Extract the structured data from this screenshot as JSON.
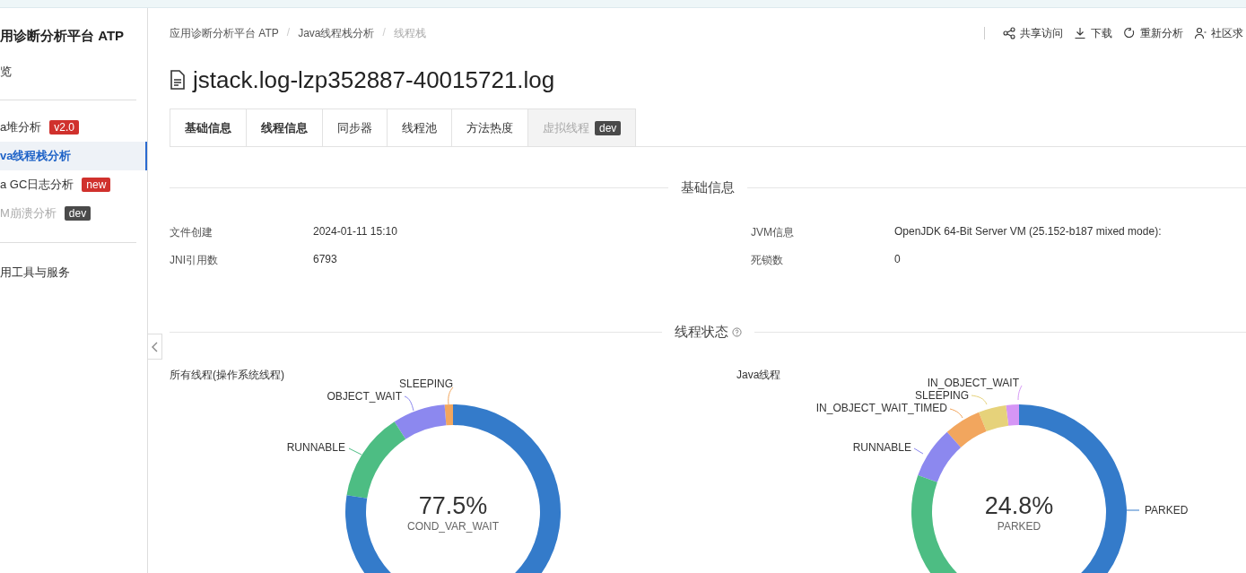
{
  "sidebar": {
    "title": "用诊断分析平台 ATP",
    "overview": "览",
    "items": [
      {
        "label": "a堆分析",
        "badge": {
          "text": "v2.0",
          "color": "#d0312d"
        },
        "selected": false,
        "disabled": false
      },
      {
        "label": "va线程栈分析",
        "selected": true,
        "disabled": false
      },
      {
        "label": "a GC日志分析",
        "badge": {
          "text": "new",
          "color": "#d0312d"
        },
        "selected": false,
        "disabled": false
      },
      {
        "label": "M崩溃分析",
        "badge": {
          "text": "dev",
          "color": "#4a4a4a"
        },
        "selected": false,
        "disabled": true
      }
    ],
    "tools": "用工具与服务"
  },
  "breadcrumb": [
    "应用诊断分析平台 ATP",
    "Java线程栈分析",
    "线程栈"
  ],
  "breadcrumb_separators": [
    "/",
    "/"
  ],
  "actions": [
    {
      "kind": "share",
      "label": "共享访问"
    },
    {
      "kind": "download",
      "label": "下载"
    },
    {
      "kind": "reload",
      "label": "重新分析"
    },
    {
      "kind": "user",
      "label": "社区求"
    }
  ],
  "title": "jstack.log-lzp352887-40015721.log",
  "tabs": [
    {
      "label": "基础信息",
      "selected": true,
      "disabled": false
    },
    {
      "label": "线程信息",
      "selected": true,
      "disabled": false
    },
    {
      "label": "同步器",
      "selected": false,
      "disabled": false
    },
    {
      "label": "线程池",
      "selected": false,
      "disabled": false
    },
    {
      "label": "方法热度",
      "selected": false,
      "disabled": false
    },
    {
      "label": "虚拟线程",
      "badge": "dev",
      "selected": false,
      "disabled": true
    }
  ],
  "basic_section": "基础信息",
  "info": [
    {
      "label": "文件创建",
      "value": "2024-01-11 15:10"
    },
    {
      "label": "JVM信息",
      "value": "OpenJDK 64-Bit Server VM (25.152-b187 mixed mode):"
    },
    {
      "label": "JNI引用数",
      "value": "6793"
    },
    {
      "label": "死锁数",
      "value": "0"
    }
  ],
  "state_section": "线程状态",
  "charts": [
    {
      "title": "所有线程(操作系统线程)",
      "center_value": "77.5%",
      "center_label": "COND_VAR_WAIT",
      "slices": [
        {
          "label": "SLEEPING",
          "color": "#f2a65e"
        },
        {
          "label": "OBJECT_WAIT",
          "color": "#8c88ef"
        },
        {
          "label": "RUNNABLE",
          "color": "#4dbd83"
        },
        {
          "color": "#347bca"
        }
      ]
    },
    {
      "title": "Java线程",
      "center_value": "24.8%",
      "center_label": "PARKED",
      "slices": [
        {
          "label": "IN_OBJECT_WAIT",
          "color": "#d596f5"
        },
        {
          "label": "SLEEPING",
          "color": "#e6d27a"
        },
        {
          "label": "IN_OBJECT_WAIT_TIMED",
          "color": "#f2a65e"
        },
        {
          "label": "RUNNABLE",
          "color": "#8c88ef"
        },
        {
          "label": "PARKED",
          "color": "#347bca"
        },
        {
          "color": "#4dbd83"
        }
      ]
    }
  ]
}
